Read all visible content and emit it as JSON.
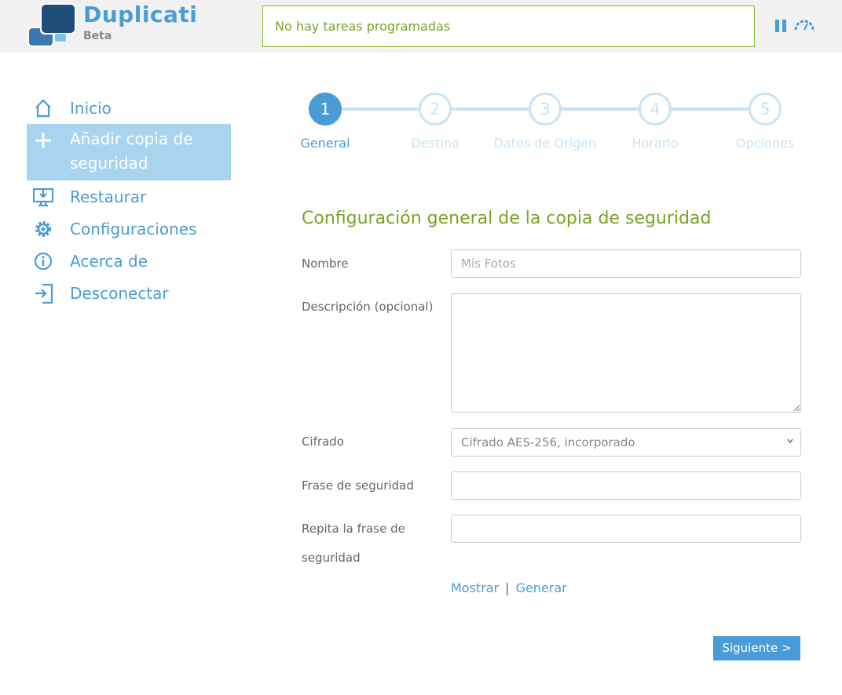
{
  "header": {
    "brand": "Duplicati",
    "badge": "Beta",
    "status": "No hay tareas programadas",
    "icons": {
      "pause": "pause-icon",
      "throttle": "speed-gauge-icon"
    }
  },
  "sidebar": {
    "items": [
      {
        "label": "Inicio",
        "icon": "home-icon",
        "active": false
      },
      {
        "label": "Añadir copia de seguridad",
        "icon": "plus-icon",
        "active": true
      },
      {
        "label": "Restaurar",
        "icon": "restore-monitor-icon",
        "active": false
      },
      {
        "label": "Configuraciones",
        "icon": "gear-icon",
        "active": false
      },
      {
        "label": "Acerca de",
        "icon": "info-icon",
        "active": false
      },
      {
        "label": "Desconectar",
        "icon": "logout-icon",
        "active": false
      }
    ]
  },
  "wizard": {
    "steps": [
      {
        "number": "1",
        "label": "General",
        "active": true
      },
      {
        "number": "2",
        "label": "Destino",
        "active": false
      },
      {
        "number": "3",
        "label": "Datos de Origen",
        "active": false
      },
      {
        "number": "4",
        "label": "Horario",
        "active": false
      },
      {
        "number": "5",
        "label": "Opciones",
        "active": false
      }
    ]
  },
  "form": {
    "title": "Configuración general de la copia de seguridad",
    "name_label": "Nombre",
    "name_placeholder": "Mis Fotos",
    "name_value": "",
    "description_label": "Descripción (opcional)",
    "description_value": "",
    "encryption_label": "Cifrado",
    "encryption_value": "Cifrado AES-256, incorporado",
    "passphrase_label": "Frase de seguridad",
    "passphrase_value": "",
    "repeat_label": "Repita la frase de seguridad",
    "repeat_value": "",
    "show_link": "Mostrar",
    "separator": "|",
    "generate_link": "Generar",
    "next_button": "Siguiente >"
  },
  "colors": {
    "accent": "#4a9cd6",
    "active_bg": "#a8d4f0",
    "green": "#7aa325",
    "header_bg": "#f1f1f1"
  }
}
